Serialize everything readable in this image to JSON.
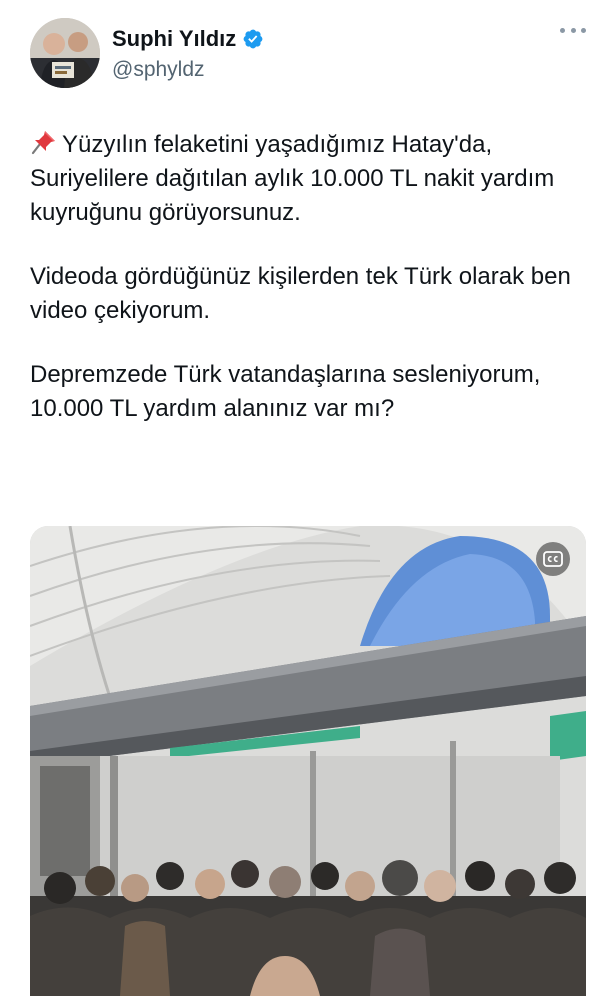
{
  "profile": {
    "name": "Suphi Yıldız",
    "handle": "@sphyldz",
    "verified": true,
    "verified_color": "#1d9bf0"
  },
  "tweet": {
    "pin_icon": "pushpin-emoji",
    "paragraph1": "Yüzyılın felaketini yaşadığımız Hatay'da, Suriyelilere dağıtılan aylık 10.000 TL nakit yardım kuyruğunu görüyorsunuz.",
    "paragraph2": "Videoda gördüğünüz kişilerden tek Türk olarak ben video çekiyorum.",
    "paragraph3": "Depremzede Türk vatandaşlarına sesleniyorum, 10.000 TL yardım alanınız var mı?"
  },
  "media": {
    "type": "video",
    "captions_icon": "closed-captions-icon"
  },
  "colors": {
    "text": "#0f1419",
    "secondary": "#536471",
    "accent": "#1d9bf0"
  }
}
